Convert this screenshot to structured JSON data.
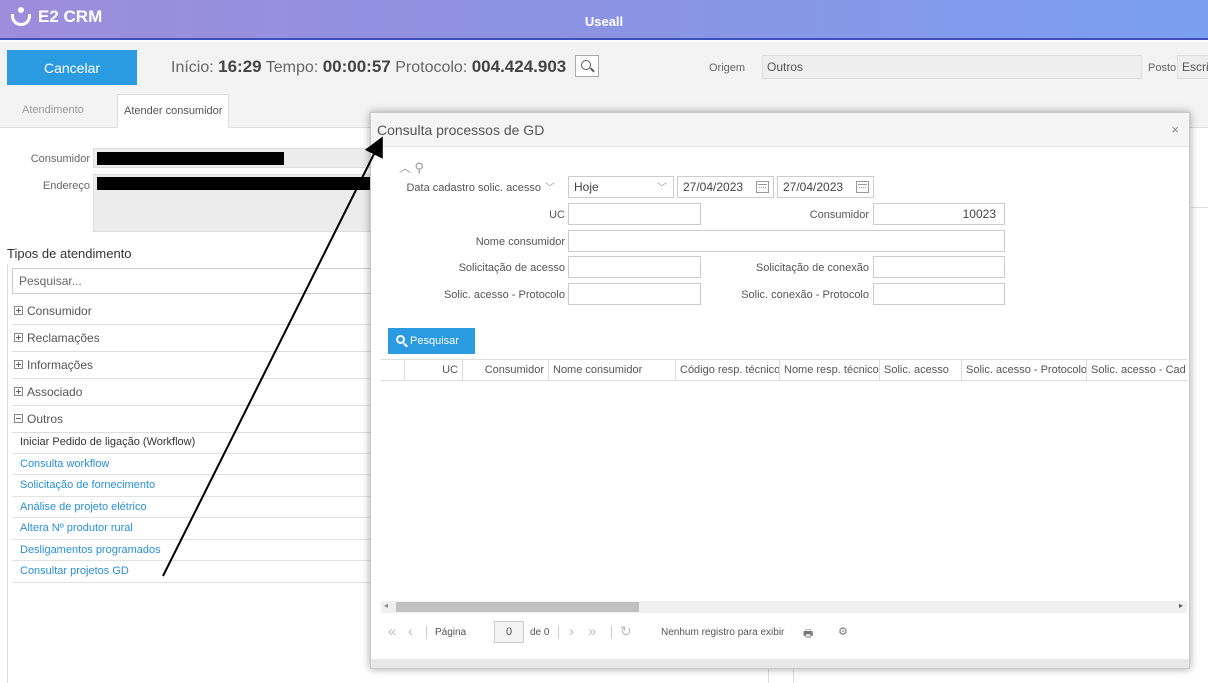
{
  "app": {
    "logo_text": "E2 CRM",
    "title": "Useall"
  },
  "toolbar": {
    "cancel_label": "Cancelar",
    "inicio_label": "Início:",
    "inicio_value": "16:29",
    "tempo_label": "Tempo:",
    "tempo_value": "00:00:57",
    "protocolo_label": "Protocolo:",
    "protocolo_value": "004.424.903",
    "origem_label": "Origem",
    "origem_value": "Outros",
    "posto_label": "Posto",
    "posto_value": "Escri"
  },
  "tabs": [
    {
      "label": "Atendimento"
    },
    {
      "label": "Atender consumidor"
    }
  ],
  "consumer": {
    "consumidor_label": "Consumidor",
    "endereco_label": "Endereço"
  },
  "types": {
    "title": "Tipos de atendimento",
    "search_placeholder": "Pesquisar...",
    "groups": [
      {
        "label": "Consumidor"
      },
      {
        "label": "Reclamações"
      },
      {
        "label": "Informações"
      },
      {
        "label": "Associado"
      },
      {
        "label": "Outros"
      }
    ],
    "items": [
      {
        "label": "Iniciar Pedido de ligação (Workflow)"
      },
      {
        "label": "Consulta workflow"
      },
      {
        "label": "Solicitação de fornecimento"
      },
      {
        "label": "Análise de projeto elétrico"
      },
      {
        "label": "Altera Nº produtor rural"
      },
      {
        "label": "Desligamentos programados"
      },
      {
        "label": "Consultar projetos GD"
      }
    ]
  },
  "modal": {
    "title": "Consulta processos de GD",
    "close": "×",
    "filters": {
      "data_cadastro_label": "Data cadastro solic. acesso",
      "period_value": "Hoje",
      "date_from": "27/04/2023",
      "date_to": "27/04/2023",
      "uc_label": "UC",
      "uc_value": "",
      "consumidor_label": "Consumidor",
      "consumidor_value": "10023",
      "nome_label": "Nome consumidor",
      "nome_value": "",
      "solic_acesso_label": "Solicitação de acesso",
      "solic_conexao_label": "Solicitação de conexão",
      "solic_acesso_prot_label": "Solic. acesso - Protocolo",
      "solic_conexao_prot_label": "Solic. conexão - Protocolo"
    },
    "search_label": "Pesquisar",
    "columns": [
      {
        "label": "UC"
      },
      {
        "label": "Consumidor"
      },
      {
        "label": "Nome consumidor"
      },
      {
        "label": "Código resp. técnico"
      },
      {
        "label": "Nome resp. técnico"
      },
      {
        "label": "Solic. acesso"
      },
      {
        "label": "Solic. acesso - Protocolo"
      },
      {
        "label": "Solic. acesso - Cad"
      }
    ],
    "pager": {
      "page_label": "Página",
      "page_value": "0",
      "of_label": "de 0",
      "empty_msg": "Nenhum registro para exibir"
    }
  }
}
